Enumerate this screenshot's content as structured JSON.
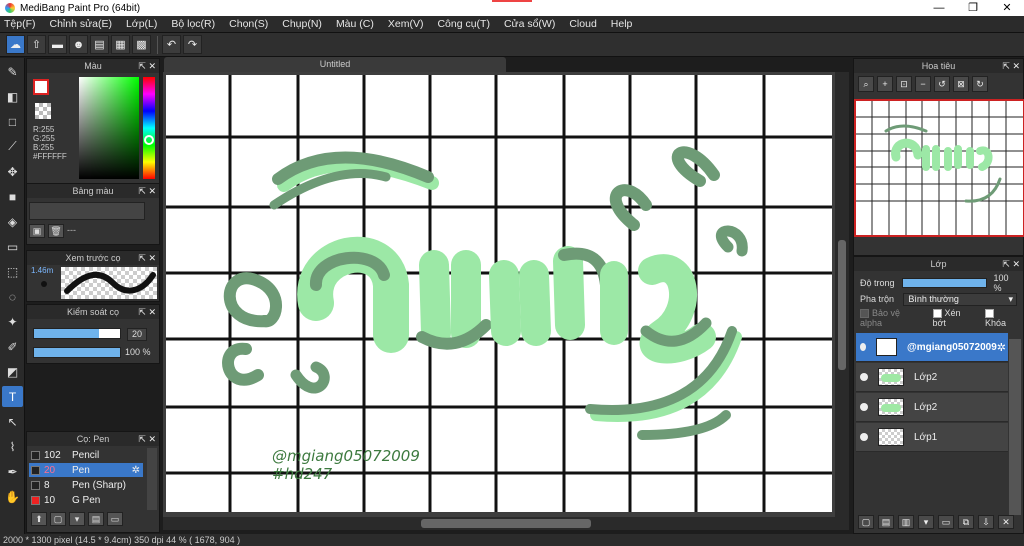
{
  "app": {
    "title": "MediBang Paint Pro (64bit)"
  },
  "window_controls": {
    "minimize": "—",
    "maximize": "❐",
    "close": "✕"
  },
  "menu": [
    "Tệp(F)",
    "Chỉnh sửa(E)",
    "Lớp(L)",
    "Bộ lọc(R)",
    "Chọn(S)",
    "Chụp(N)",
    "Màu (C)",
    "Xem(V)",
    "Công cụ(T)",
    "Cửa sổ(W)",
    "Cloud",
    "Help"
  ],
  "canvas_tab": {
    "title": "Untitled"
  },
  "color_panel": {
    "title": "Màu",
    "r": "R:255",
    "g": "G:255",
    "b": "B:255",
    "hex": "#FFFFFF"
  },
  "palette_panel": {
    "title": "Bảng màu",
    "dash": "---"
  },
  "preview_panel": {
    "title": "Xem trước cọ",
    "size": "1.46m"
  },
  "brush_control": {
    "title": "Kiểm soát cọ",
    "size_value": "20",
    "opacity_value": "100 %",
    "size_fraction": 0.75,
    "opacity_fraction": 1.0
  },
  "brush_panel": {
    "title": "Cọ: Pen",
    "items": [
      {
        "num": "102",
        "name": "Pencil",
        "color": "#222222"
      },
      {
        "num": "20",
        "name": "Pen",
        "color": "#222222"
      },
      {
        "num": "8",
        "name": "Pen (Sharp)",
        "color": "#222222"
      },
      {
        "num": "10",
        "name": "G Pen",
        "color": "#ee2222"
      }
    ]
  },
  "navigator": {
    "title": "Hoa tiêu"
  },
  "layer_panel": {
    "title": "Lớp",
    "opacity_label": "Độ trong",
    "opacity_value": "100 %",
    "blend_label": "Pha trộn",
    "blend_value": "Bình thường",
    "protect_alpha": "Bảo vệ alpha",
    "clipping": "Xén bớt",
    "lock": "Khóa",
    "layers": [
      "@mgiang05072009",
      "Lớp2",
      "Lớp2",
      "Lớp1"
    ]
  },
  "artwork": {
    "signature": "@mgiang05072009",
    "tag": "#hd247",
    "text_color": "#3d7a3f"
  },
  "status": {
    "text": "2000 * 1300 pixel   (14.5 * 9.4cm)   350 dpi   44 %   ( 1678, 904 )"
  },
  "colors": {
    "accent": "#3a78c9",
    "art_light": "#9fe8a4",
    "art_dark": "#6e9b76"
  }
}
